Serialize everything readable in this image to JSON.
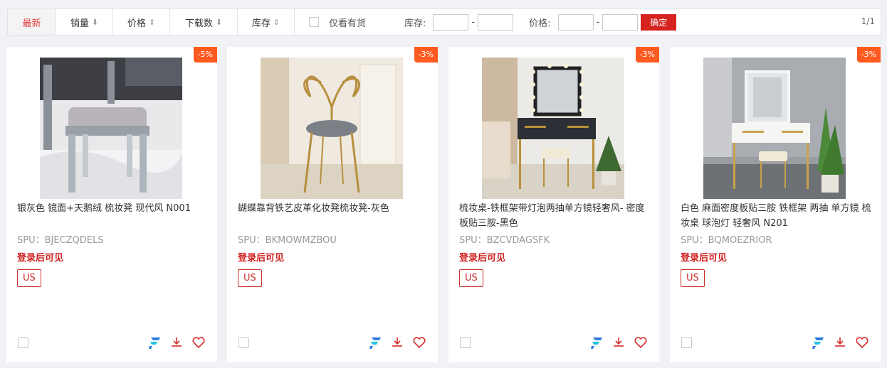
{
  "filter_bar": {
    "tabs": [
      {
        "label": "最新",
        "arrow": ""
      },
      {
        "label": "销量",
        "arrow": "⬇"
      },
      {
        "label": "价格",
        "arrow": "⇕"
      },
      {
        "label": "下载数",
        "arrow": "⬇"
      },
      {
        "label": "库存",
        "arrow": "⇕"
      }
    ],
    "in_stock_only_label": "仅看有货",
    "in_stock_only_checked": false,
    "stock_range_label": "库存:",
    "stock_min": "",
    "stock_max": "",
    "price_range_label": "价格:",
    "price_min": "",
    "price_max": "",
    "range_separator": "-",
    "confirm_label": "确定",
    "pager": "1/1"
  },
  "products": [
    {
      "discount": "-5%",
      "title": "银灰色 镜面+天鹅绒 梳妆凳 现代风 N001",
      "spu": "SPU：BJECZQDELS",
      "price_notice": "登录后可见",
      "region_tag": "US",
      "image": "mirrored-vanity-stool-photo"
    },
    {
      "discount": "-3%",
      "title": "蝴蝶靠背铁艺皮革化妆凳梳妆凳-灰色",
      "spu": "SPU：BKMOWMZBOU",
      "price_notice": "登录后可见",
      "region_tag": "US",
      "image": "butterfly-back-chair-photo"
    },
    {
      "discount": "-3%",
      "title": "梳妆桌-铁框架带灯泡两抽单方镜轻奢风- 密度板贴三胺-黑色",
      "spu": "SPU：BZCVDAGSFK",
      "price_notice": "登录后可见",
      "region_tag": "US",
      "image": "black-vanity-desk-photo"
    },
    {
      "discount": "-3%",
      "title": "白色 麻面密度板贴三胺 铁框架 两抽 单方镜 梳妆桌 球泡灯 轻奢风 N201",
      "spu": "SPU：BQMOEZRIOR",
      "price_notice": "登录后可见",
      "region_tag": "US",
      "image": "white-vanity-desk-photo"
    }
  ],
  "icons": {
    "distribute": "brand-f-icon",
    "download": "download-icon",
    "favorite": "heart-icon"
  },
  "colors": {
    "accent_red": "#d6231f",
    "discount_orange": "#ff5a1f",
    "brand_blue": "#2f7de1",
    "brand_cyan": "#21c3e6"
  }
}
